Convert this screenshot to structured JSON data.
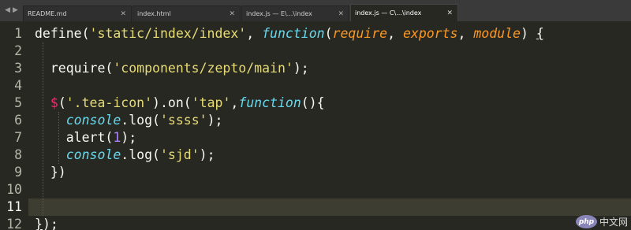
{
  "tabs": {
    "nav_left": "◀",
    "nav_right": "▶",
    "close_glyph": "×",
    "items": [
      {
        "label": "README.md"
      },
      {
        "label": "index.html"
      },
      {
        "label": "index.js — E\\...\\index"
      },
      {
        "label": "index.js — C\\...\\index"
      }
    ],
    "active_index": 3
  },
  "editor": {
    "current_line": 11,
    "line_numbers": [
      "1",
      "2",
      "3",
      "4",
      "5",
      "6",
      "7",
      "8",
      "9",
      "10",
      "11",
      "12"
    ],
    "lines": [
      {
        "tokens": [
          {
            "t": "define(",
            "c": "plain"
          },
          {
            "t": "'static/index/index'",
            "c": "str"
          },
          {
            "t": ", ",
            "c": "plain"
          },
          {
            "t": "function",
            "c": "fn"
          },
          {
            "t": "(",
            "c": "plain"
          },
          {
            "t": "require",
            "c": "arg"
          },
          {
            "t": ", ",
            "c": "plain"
          },
          {
            "t": "exports",
            "c": "arg"
          },
          {
            "t": ", ",
            "c": "plain"
          },
          {
            "t": "module",
            "c": "arg"
          },
          {
            "t": ") ",
            "c": "plain"
          },
          {
            "t": "{",
            "c": "caret"
          }
        ]
      },
      {
        "tokens": []
      },
      {
        "tokens": [
          {
            "t": "  require(",
            "c": "plain"
          },
          {
            "t": "'components/zepto/main'",
            "c": "str"
          },
          {
            "t": ");",
            "c": "plain"
          }
        ]
      },
      {
        "tokens": []
      },
      {
        "tokens": [
          {
            "t": "  ",
            "c": "plain"
          },
          {
            "t": "$",
            "c": "kw"
          },
          {
            "t": "(",
            "c": "plain"
          },
          {
            "t": "'.tea-icon'",
            "c": "str"
          },
          {
            "t": ").on(",
            "c": "plain"
          },
          {
            "t": "'tap'",
            "c": "str"
          },
          {
            "t": ",",
            "c": "plain"
          },
          {
            "t": "function",
            "c": "fn"
          },
          {
            "t": "(){",
            "c": "plain"
          }
        ]
      },
      {
        "tokens": [
          {
            "t": "    ",
            "c": "plain"
          },
          {
            "t": "console",
            "c": "fn"
          },
          {
            "t": ".log(",
            "c": "plain"
          },
          {
            "t": "'ssss'",
            "c": "str"
          },
          {
            "t": ");",
            "c": "plain"
          }
        ]
      },
      {
        "tokens": [
          {
            "t": "    alert(",
            "c": "plain"
          },
          {
            "t": "1",
            "c": "num"
          },
          {
            "t": ");",
            "c": "plain"
          }
        ]
      },
      {
        "tokens": [
          {
            "t": "    ",
            "c": "plain"
          },
          {
            "t": "console",
            "c": "fn"
          },
          {
            "t": ".log(",
            "c": "plain"
          },
          {
            "t": "'sjd'",
            "c": "str"
          },
          {
            "t": ");",
            "c": "plain"
          }
        ]
      },
      {
        "tokens": [
          {
            "t": "  })",
            "c": "plain"
          }
        ]
      },
      {
        "tokens": []
      },
      {
        "tokens": []
      },
      {
        "tokens": [
          {
            "t": "}",
            "c": "caret"
          },
          {
            "t": ");",
            "c": "plain"
          }
        ]
      }
    ]
  },
  "watermark": {
    "logo": "php",
    "text": "中文网"
  },
  "colors": {
    "background": "#272822",
    "foreground": "#f8f8f2",
    "string": "#e6db74",
    "storage": "#66d9ef",
    "parameter": "#fd971f",
    "keyword": "#f92672",
    "number": "#ae81ff",
    "current_line": "#3e3d32",
    "tabbar": "#3a3a3a"
  }
}
